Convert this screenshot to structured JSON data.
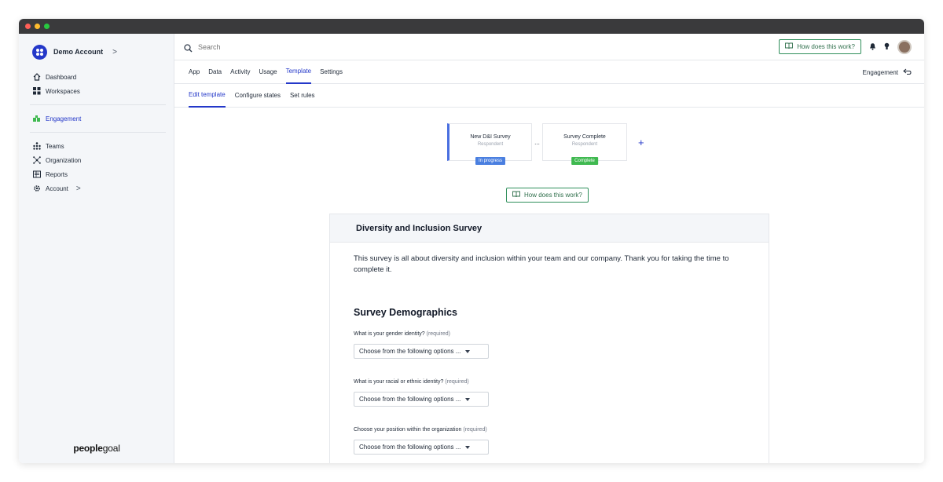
{
  "window": {
    "dots": [
      "#ff5f57",
      "#febc2e",
      "#28c840"
    ]
  },
  "sidebar": {
    "account_name": "Demo Account",
    "account_chevron": ">",
    "items_top": [
      {
        "label": "Dashboard",
        "icon": "home-icon"
      },
      {
        "label": "Workspaces",
        "icon": "grid-icon"
      }
    ],
    "engagement": {
      "label": "Engagement",
      "icon": "puzzle-icon"
    },
    "items_bottom": [
      {
        "label": "Teams",
        "icon": "teams-icon"
      },
      {
        "label": "Organization",
        "icon": "organization-icon"
      },
      {
        "label": "Reports",
        "icon": "reports-icon"
      },
      {
        "label": "Account",
        "icon": "gear-icon",
        "chevron": ">"
      }
    ],
    "logo_bold": "people",
    "logo_light": "goal"
  },
  "topbar": {
    "search_placeholder": "Search",
    "how_label": "How does this work?"
  },
  "tabs": {
    "items": [
      "App",
      "Data",
      "Activity",
      "Usage",
      "Template",
      "Settings"
    ],
    "active": "Template",
    "right_link": "Engagement"
  },
  "subtabs": {
    "items": [
      "Edit template",
      "Configure states",
      "Set rules"
    ],
    "active": "Edit template"
  },
  "workflow": {
    "states": [
      {
        "title": "New D&I Survey",
        "subtitle": "Respondent",
        "badge": "In progress",
        "badge_color": "#4a7fe0"
      },
      {
        "title": "Survey Complete",
        "subtitle": "Respondent",
        "badge": "Complete",
        "badge_color": "#3fb950"
      }
    ],
    "connector": "...",
    "add": "+"
  },
  "how_center_label": "How does this work?",
  "form": {
    "title": "Diversity and Inclusion Survey",
    "intro": "This survey is all about diversity and inclusion within your team and our company. Thank you for taking the time to complete it.",
    "section": "Survey Demographics",
    "questions": [
      {
        "label": "What is your gender identity?",
        "required": "(required)",
        "placeholder": "Choose from the following options ..."
      },
      {
        "label": "What is your racial or ethnic identity?",
        "required": "(required)",
        "placeholder": "Choose from the following options ..."
      },
      {
        "label": "Choose your position within the organization",
        "required": "(required)",
        "placeholder": "Choose from the following options ..."
      }
    ]
  },
  "colors": {
    "accent": "#2438c9",
    "green": "#2f8f5b"
  }
}
